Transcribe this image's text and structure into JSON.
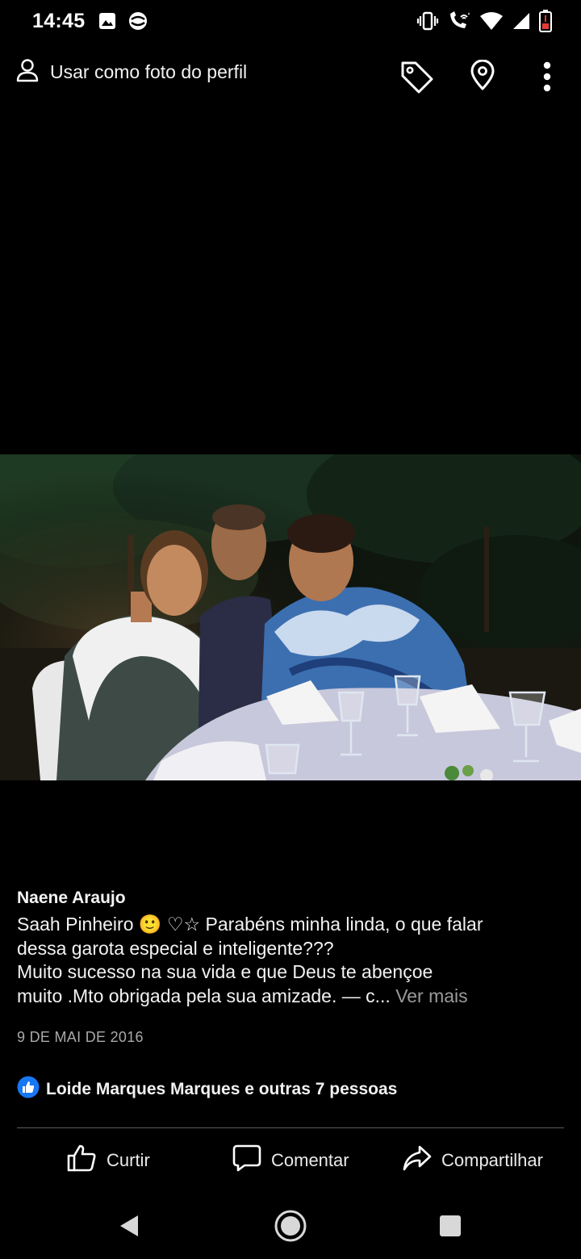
{
  "status_bar": {
    "time": "14:45",
    "left_icons": [
      "gallery-icon",
      "app-notification-icon"
    ],
    "right_icons": [
      "vibrate-icon",
      "wifi-call-icon",
      "wifi-icon",
      "signal-icon",
      "battery-low-icon"
    ],
    "battery_color": "#e53935"
  },
  "toolbar": {
    "profile_label": "Usar como foto do perfil",
    "icons": [
      "user-icon",
      "tag-icon",
      "location-pin-icon",
      "more-vertical-icon"
    ]
  },
  "post": {
    "author": "Naene Araujo",
    "caption_lines": [
      "Saah Pinheiro 🙂 ♡☆  Parabéns minha linda, o que falar",
      "dessa garota especial e inteligente???",
      "Muito sucesso na sua vida e que Deus te abençoe",
      "muito .Mto obrigada pela sua amizade. — c..."
    ],
    "see_more": "Ver mais",
    "date": "9 DE MAI DE 2016",
    "reactions_text": "Loide Marques Marques e outras 7 pessoas",
    "like_badge_color": "#1877f2"
  },
  "actions": {
    "like": "Curtir",
    "comment": "Comentar",
    "share": "Compartilhar"
  },
  "nav": [
    "back-icon",
    "home-icon",
    "recents-icon"
  ]
}
